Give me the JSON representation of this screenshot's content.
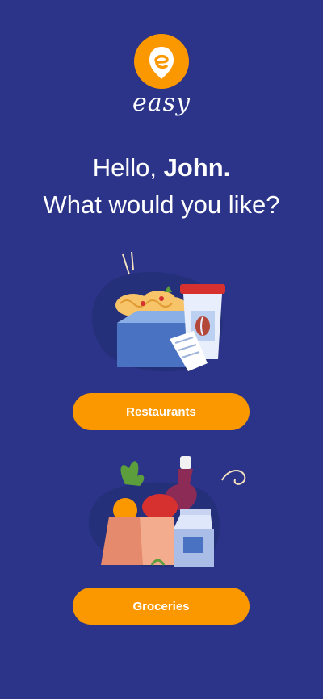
{
  "brand": {
    "name": "easy",
    "logo_icon": "easy-location-pin-icon",
    "accent_color": "#fb9800",
    "background_color": "#2b3489"
  },
  "greeting": {
    "prefix": "Hello,",
    "user_name": "John.",
    "question": "What would you like?"
  },
  "options": [
    {
      "label": "Restaurants",
      "illustration": "restaurant-takeout-icon"
    },
    {
      "label": "Groceries",
      "illustration": "groceries-bag-icon"
    }
  ]
}
